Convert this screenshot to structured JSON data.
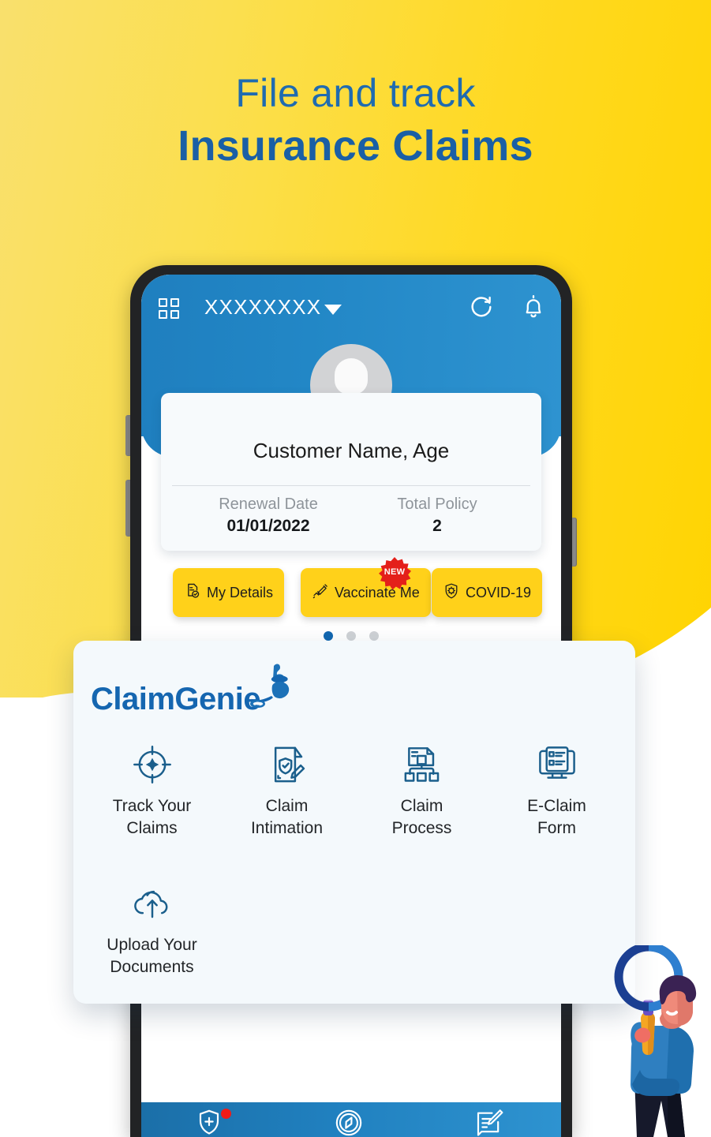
{
  "hero": {
    "line1": "File and track",
    "line2": "Insurance Claims",
    "gradient_from": "#f9e06d",
    "gradient_to": "#ffd400",
    "text_color": "#1a5fa5"
  },
  "phone": {
    "app_bar": {
      "grid_icon": "grid-icon",
      "policy_label": "XXXXXXXX",
      "dropdown_icon": "chevron-down-icon",
      "refresh_icon": "refresh-icon",
      "bell_icon": "bell-icon",
      "background_color": "#2287c6"
    },
    "profile": {
      "avatar_icon": "user-avatar-icon",
      "customer_name": "Customer Name, Age",
      "stats": [
        {
          "key": "Renewal Date",
          "value": "01/01/2022"
        },
        {
          "key": "Total Policy",
          "value": "2"
        }
      ]
    },
    "chips": [
      {
        "label": "My Details",
        "icon": "document-check-icon",
        "badge": null
      },
      {
        "label": "Vaccinate Me",
        "icon": "syringe-icon",
        "badge": "NEW"
      },
      {
        "label": "COVID-19",
        "icon": "shield-virus-icon",
        "badge": null
      }
    ],
    "chip_color": "#ffd11a",
    "badge_color": "#e41f1a",
    "pager": {
      "total": 3,
      "active": 1,
      "active_color": "#1267b0",
      "inactive_color": "#cfd2d5"
    },
    "bottom_nav": [
      {
        "icon": "shield-plus-icon",
        "has_dot": true
      },
      {
        "icon": "compass-icon",
        "has_dot": false
      },
      {
        "icon": "note-edit-icon",
        "has_dot": false
      }
    ]
  },
  "genie_card": {
    "logo_text": "ClaimGenie",
    "logo_icon": "genie-lamp-icon",
    "logo_color": "#1566b0",
    "features": [
      {
        "label": "Track Your\nClaims",
        "icon": "target-crosshair-icon"
      },
      {
        "label": "Claim\nIntimation",
        "icon": "document-pencil-icon"
      },
      {
        "label": "Claim\nProcess",
        "icon": "flowchart-document-icon"
      },
      {
        "label": "E-Claim\nForm",
        "icon": "monitor-list-icon"
      },
      {
        "label": "Upload Your\nDocuments",
        "icon": "cloud-upload-icon"
      }
    ]
  },
  "illustration": {
    "name": "man-with-magnifying-glass",
    "lens_color": "#1b62b5",
    "shirt_color": "#2f7fc0",
    "hair_color": "#3a2253",
    "handle_color": "#f5a623"
  }
}
